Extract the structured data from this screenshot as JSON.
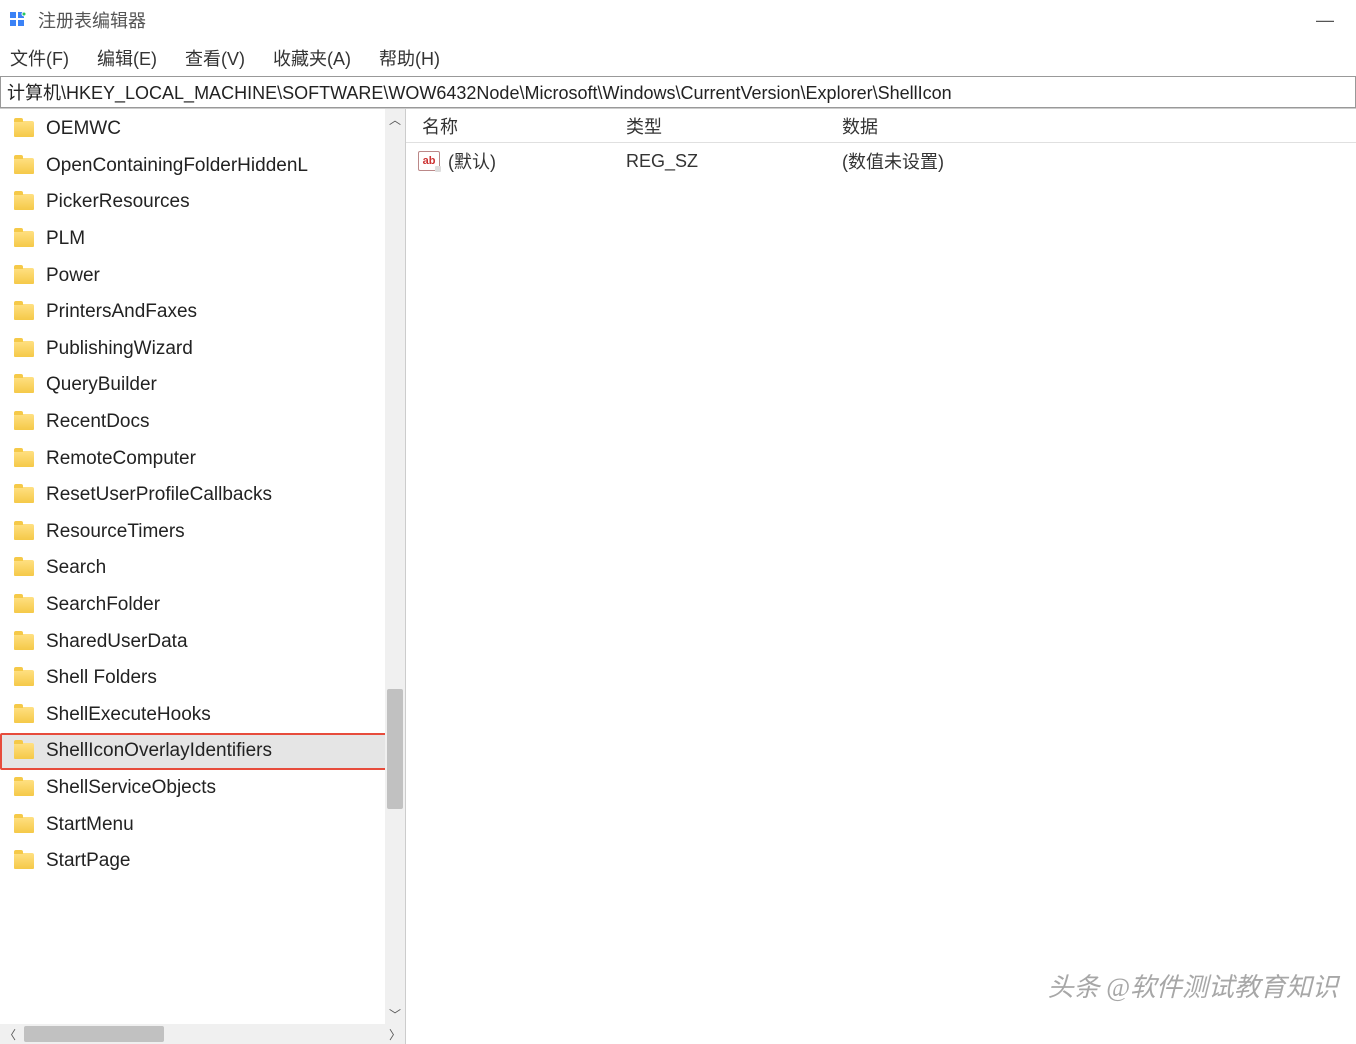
{
  "window": {
    "title": "注册表编辑器",
    "minimize_label": "—"
  },
  "menu": {
    "file": "文件(F)",
    "edit": "编辑(E)",
    "view": "查看(V)",
    "favorites": "收藏夹(A)",
    "help": "帮助(H)"
  },
  "address": "计算机\\HKEY_LOCAL_MACHINE\\SOFTWARE\\WOW6432Node\\Microsoft\\Windows\\CurrentVersion\\Explorer\\ShellIcon",
  "tree": {
    "items": [
      {
        "label": "OEMWC",
        "selected": false
      },
      {
        "label": "OpenContainingFolderHiddenL",
        "selected": false
      },
      {
        "label": "PickerResources",
        "selected": false
      },
      {
        "label": "PLM",
        "selected": false
      },
      {
        "label": "Power",
        "selected": false
      },
      {
        "label": "PrintersAndFaxes",
        "selected": false
      },
      {
        "label": "PublishingWizard",
        "selected": false
      },
      {
        "label": "QueryBuilder",
        "selected": false
      },
      {
        "label": "RecentDocs",
        "selected": false
      },
      {
        "label": "RemoteComputer",
        "selected": false
      },
      {
        "label": "ResetUserProfileCallbacks",
        "selected": false
      },
      {
        "label": "ResourceTimers",
        "selected": false
      },
      {
        "label": "Search",
        "selected": false
      },
      {
        "label": "SearchFolder",
        "selected": false
      },
      {
        "label": "SharedUserData",
        "selected": false
      },
      {
        "label": "Shell Folders",
        "selected": false
      },
      {
        "label": "ShellExecuteHooks",
        "selected": false
      },
      {
        "label": "ShellIconOverlayIdentifiers",
        "selected": true,
        "highlighted": true
      },
      {
        "label": "ShellServiceObjects",
        "selected": false
      },
      {
        "label": "StartMenu",
        "selected": false
      },
      {
        "label": "StartPage",
        "selected": false
      }
    ]
  },
  "values": {
    "headers": {
      "name": "名称",
      "type": "类型",
      "data": "数据"
    },
    "rows": [
      {
        "name": "(默认)",
        "type": "REG_SZ",
        "data": "(数值未设置)"
      }
    ]
  },
  "icons": {
    "string_label": "ab"
  },
  "watermark": "头条 @软件测试教育知识"
}
